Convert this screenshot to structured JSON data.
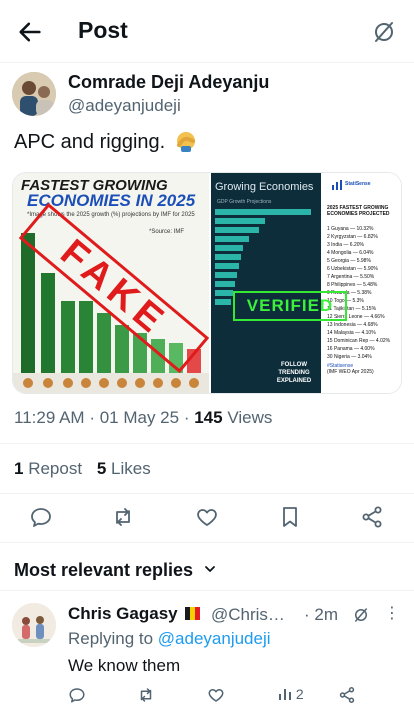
{
  "header": {
    "title": "Post"
  },
  "post": {
    "author_name": "Comrade Deji Adeyanju",
    "author_handle": "@adeyanjudeji",
    "text": "APC and rigging.",
    "time": "11:29 AM",
    "date": "01 May 25",
    "views_count": "145",
    "views_label": "Views",
    "reposts_count": "1",
    "reposts_label": "Repost",
    "likes_count": "5",
    "likes_label": "Likes"
  },
  "media": {
    "left_image": {
      "title_line1": "FASTEST GROWING",
      "title_line2": "ECONOMIES IN 2025",
      "caption": "*Image shows the 2025 growth (%) projections by IMF for 2025",
      "source": "*Source: IMF",
      "stamp": "FAKE"
    },
    "right_image": {
      "panel_title": "Growing Economies",
      "panel_sub": "GDP Growth Projections",
      "stamp": "VERIFIED",
      "follow_text": "FOLLOW TRENDING EXPLAINED",
      "brand": "StatiSense",
      "list_title": "2025 FASTEST GROWING ECONOMIES PROJECTED",
      "rows": [
        "1 Guyana — 10.32%",
        "2 Kyrgyzstan — 6.82%",
        "3 India — 6.20%",
        "4 Mongolia — 6.04%",
        "5 Georgia — 5.98%",
        "6 Uzbekistan — 5.90%",
        "7 Argentina — 5.50%",
        "8 Philippines — 5.48%",
        "9 Rwanda — 5.38%",
        "10 Togo — 5.3%",
        "11 Tajikistan — 5.15%",
        "12 Sierra Leone — 4.66%",
        "13 Indonesia — 4.68%",
        "14 Malaysia — 4.10%",
        "15 Dominican Rep — 4.02%",
        "16 Panama — 4.00%",
        "30 Nigeria — 3.04%"
      ],
      "tag": "#Statisense",
      "source": "(IMF WEO Apr 2025)"
    }
  },
  "replies": {
    "section_title": "Most relevant replies",
    "items": [
      {
        "name": "Chris Gagasy",
        "handle": "@Chris…",
        "time": "· 2m",
        "replying_prefix": "Replying to",
        "replying_handle": "@adeyanjudeji",
        "text": "We know them",
        "views": "2"
      }
    ]
  },
  "colors": {
    "accent": "#1d9bf0",
    "secondary_text": "#536471",
    "fake_red": "#e01b1b",
    "verified_green": "#34e834"
  }
}
